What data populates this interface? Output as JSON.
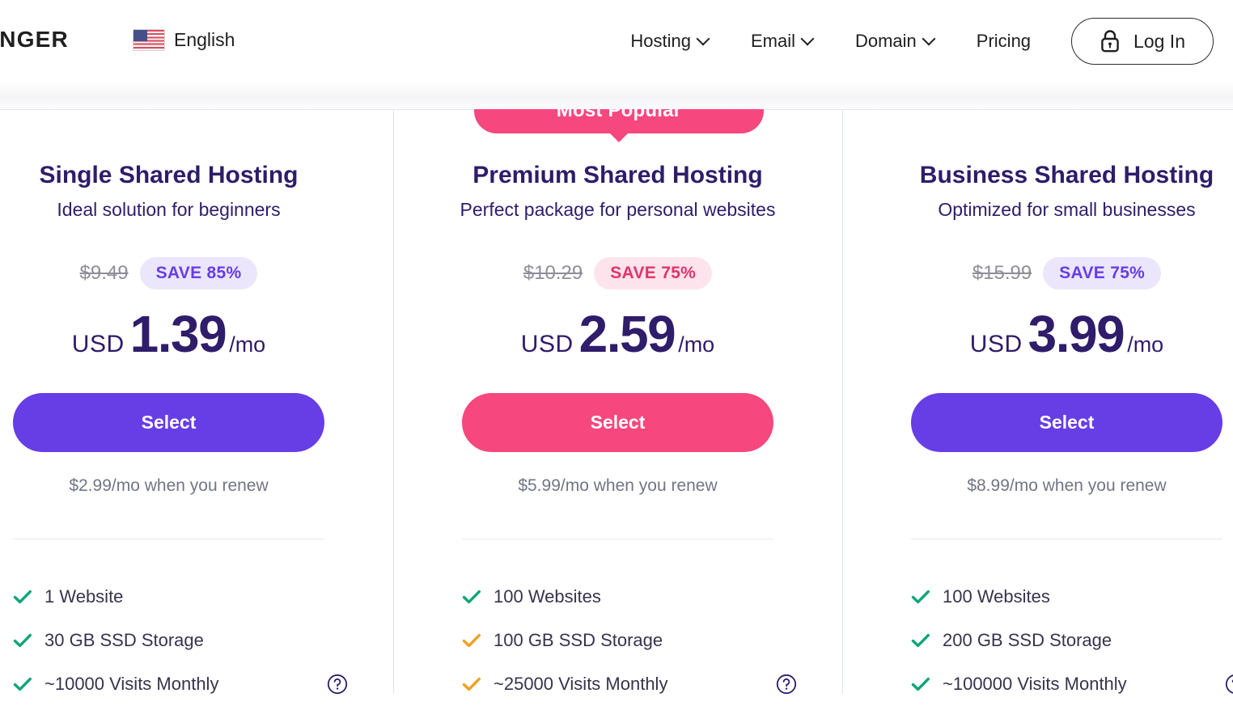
{
  "header": {
    "logo_text": "TINGER",
    "language": {
      "label": "English",
      "flag": "us-flag-icon"
    },
    "nav_items": [
      {
        "label": "Hosting",
        "has_chevron": true
      },
      {
        "label": "Email",
        "has_chevron": true
      },
      {
        "label": "Domain",
        "has_chevron": true
      },
      {
        "label": "Pricing",
        "has_chevron": false
      }
    ],
    "login": {
      "label": "Log In",
      "icon": "lock-icon"
    }
  },
  "popular_badge": {
    "label": "Most Popular"
  },
  "colors": {
    "purple": "#673de6",
    "pink": "#f6477e",
    "dark_purple": "#2f1c6a",
    "green_check": "#0ca678",
    "orange_check": "#f0a020",
    "save_pill_purple_bg": "#ebe6fb",
    "save_pill_pink_bg": "#fde4ec",
    "save_pill_pink_text": "#e4326b",
    "muted_text": "#727586",
    "divider": "#dde3f3"
  },
  "plans": [
    {
      "id": "single-shared-hosting",
      "title": "Single Shared Hosting",
      "subtitle": "Ideal solution for beginners",
      "old_price": "$9.49",
      "save_label": "SAVE 85%",
      "save_style": "purple",
      "currency": "USD",
      "price": "1.39",
      "period": "/mo",
      "select_label": "Select",
      "select_style": "purple",
      "renew_text": "$2.99/mo when you renew",
      "divider_style": "gray",
      "features": [
        {
          "label": "1 Website",
          "check_color": "green",
          "help": false
        },
        {
          "label": "30 GB SSD Storage",
          "check_color": "green",
          "help": false
        },
        {
          "label": "~10000 Visits Monthly",
          "check_color": "green",
          "help": true
        }
      ]
    },
    {
      "id": "premium-shared-hosting",
      "title": "Premium Shared Hosting",
      "subtitle": "Perfect package for personal websites",
      "old_price": "$10.29",
      "save_label": "SAVE 75%",
      "save_style": "pink",
      "currency": "USD",
      "price": "2.59",
      "period": "/mo",
      "select_label": "Select",
      "select_style": "pink",
      "renew_text": "$5.99/mo when you renew",
      "divider_style": "pinkish",
      "features": [
        {
          "label": "100 Websites",
          "check_color": "green",
          "help": false
        },
        {
          "label": "100 GB SSD Storage",
          "check_color": "orange",
          "help": false
        },
        {
          "label": "~25000 Visits Monthly",
          "check_color": "orange",
          "help": true
        }
      ]
    },
    {
      "id": "business-shared-hosting",
      "title": "Business Shared Hosting",
      "subtitle": "Optimized for small businesses",
      "old_price": "$15.99",
      "save_label": "SAVE 75%",
      "save_style": "purple",
      "currency": "USD",
      "price": "3.99",
      "period": "/mo",
      "select_label": "Select",
      "select_style": "purple",
      "renew_text": "$8.99/mo when you renew",
      "divider_style": "gray",
      "features": [
        {
          "label": "100 Websites",
          "check_color": "green",
          "help": false
        },
        {
          "label": "200 GB SSD Storage",
          "check_color": "green",
          "help": false
        },
        {
          "label": "~100000 Visits Monthly",
          "check_color": "green",
          "help": true
        }
      ]
    }
  ]
}
